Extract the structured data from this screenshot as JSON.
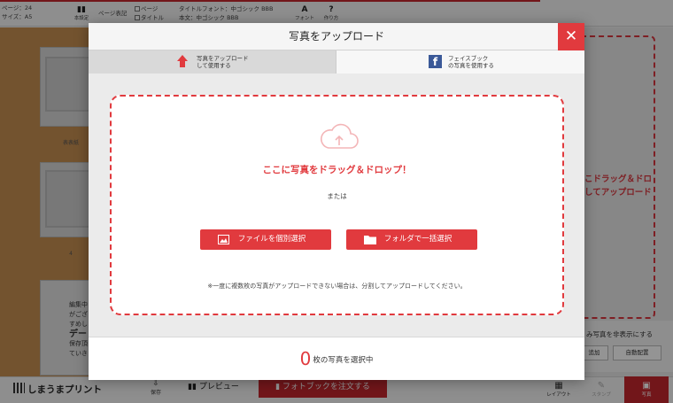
{
  "topbar": {
    "pages": "ページ：24",
    "size": "サイズ：A5",
    "settings": "本設定",
    "page_label_heading": "ページ表記",
    "opt_page": "ページ",
    "opt_title": "タイトル",
    "title_font": "タイトルフォント：中ゴシック BBB",
    "body_font": "本文：中ゴシック BBB",
    "font": "フォント",
    "help": "作り方"
  },
  "left_panel": {
    "cover_label": "表表紙",
    "page_num": "4",
    "text_lines": [
      "編集中",
      "がござ",
      "すめし",
      "デー",
      "保存頂",
      "ていき"
    ]
  },
  "right_area": {
    "drop_hint_line1": "こドラッグ＆ドロ",
    "drop_hint_line2": "してアップロード",
    "hide_text": "み写真を非表示にする",
    "add_btn": "追加",
    "auto_btn": "自動配置"
  },
  "bottombar": {
    "logo": "しまうまプリント",
    "save": "保存",
    "preview": "プレビュー",
    "order": "フォトブックを注文する",
    "layout": "レイアウト",
    "stamp": "スタンプ",
    "photo": "写真"
  },
  "modal": {
    "title": "写真をアップロード",
    "close": "✕",
    "tabs": [
      {
        "line1": "写真をアップロード",
        "line2": "して使用する"
      },
      {
        "line1": "フェイスブック",
        "line2": "の写真を使用する"
      }
    ],
    "drop_main": "ここに写真をドラッグ＆ドロップ！",
    "or_text": "または",
    "btn_files": "ファイルを個別選択",
    "btn_folder": "フォルダで一括選択",
    "note": "※一度に複数枚の写真がアップロードできない場合は、分割してアップロードしてください。",
    "count": "0",
    "count_suffix": "枚の写真を選択中"
  }
}
